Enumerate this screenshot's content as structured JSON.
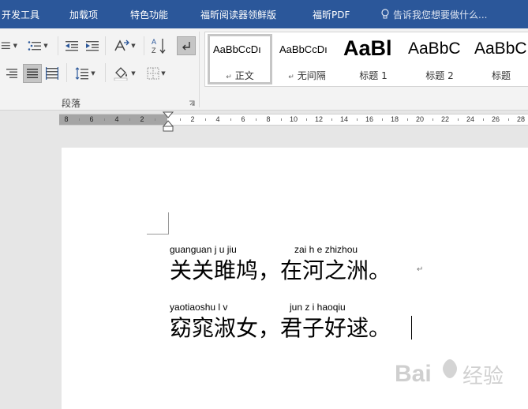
{
  "tabs": [
    {
      "label": "开发工具"
    },
    {
      "label": "加载项"
    },
    {
      "label": "特色功能"
    },
    {
      "label": "福昕阅读器领鲜版"
    },
    {
      "label": "福昕PDF"
    }
  ],
  "tell_me": {
    "text": "告诉我您想要做什么..."
  },
  "paragraph_group": {
    "label": "段落"
  },
  "styles": [
    {
      "preview": "AaBbCcDı",
      "name": "正文",
      "has_mark": true
    },
    {
      "preview": "AaBbCcDı",
      "name": "无间隔",
      "has_mark": true
    },
    {
      "preview": "AaBl",
      "name": "标题 1",
      "has_mark": false
    },
    {
      "preview": "AaBbC",
      "name": "标题 2",
      "has_mark": false
    },
    {
      "preview": "AaBbC",
      "name": "标题",
      "has_mark": false
    }
  ],
  "ruler": {
    "left_numbers": [
      "8",
      "6",
      "4",
      "2"
    ],
    "right_numbers": [
      "2",
      "4",
      "6",
      "8",
      "10",
      "12",
      "14",
      "16",
      "18",
      "20",
      "22",
      "24",
      "26",
      "28"
    ]
  },
  "document": {
    "lines": [
      {
        "pinyin_left": "guanguan j u jiu",
        "pinyin_right": "zai h e zhizhou",
        "hanzi": "关关雎鸠，在河之洲。"
      },
      {
        "pinyin_left": "yaotiaoshu l v",
        "pinyin_right": "jun z i haoqiu",
        "hanzi": "窈窕淑女，君子好逑。"
      }
    ]
  },
  "watermark": {
    "text": "Bai 经验"
  },
  "colors": {
    "ribbon_blue": "#2b579a",
    "ribbon_gray": "#f3f3f3",
    "page": "#ffffff"
  }
}
